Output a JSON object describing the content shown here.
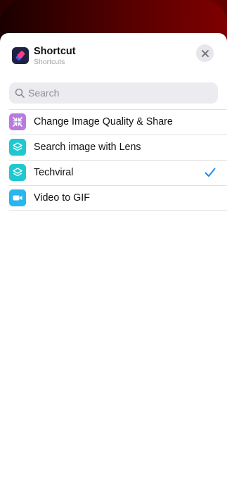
{
  "header": {
    "title": "Shortcut",
    "subtitle": "Shortcuts",
    "app_icon": "shortcuts-app-icon",
    "close_icon": "close-icon"
  },
  "search": {
    "placeholder": "Search",
    "value": "",
    "icon": "search-icon"
  },
  "shortcuts": [
    {
      "label": "Change Image Quality & Share",
      "icon": "compress-arrows-icon",
      "color": "#b97be0",
      "selected": false
    },
    {
      "label": "Search image with Lens",
      "icon": "layers-icon",
      "color": "#1fc8cf",
      "selected": false
    },
    {
      "label": "Techviral",
      "icon": "layers-icon",
      "color": "#1fc8cf",
      "selected": true
    },
    {
      "label": "Video to GIF",
      "icon": "video-camera-icon",
      "color": "#29b5ef",
      "selected": false
    }
  ],
  "colors": {
    "accent": "#1a8cf0",
    "backdrop": "#7a0000"
  }
}
